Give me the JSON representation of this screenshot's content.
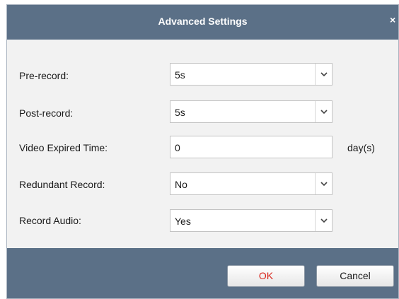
{
  "dialog": {
    "title": "Advanced Settings",
    "close_symbol": "×"
  },
  "fields": [
    {
      "label": "Pre-record:",
      "value": "5s",
      "type": "select"
    },
    {
      "label": "Post-record:",
      "value": "5s",
      "type": "select"
    },
    {
      "label": "Video Expired Time:",
      "value": "0",
      "type": "input",
      "unit": "day(s)"
    },
    {
      "label": "Redundant Record:",
      "value": "No",
      "type": "select"
    },
    {
      "label": "Record Audio:",
      "value": "Yes",
      "type": "select"
    }
  ],
  "buttons": {
    "ok_label": "OK",
    "cancel_label": "Cancel"
  },
  "colors": {
    "header": "#5b7087",
    "ok_text": "#d9261c"
  },
  "icons": {
    "dropdown": "chevron-down-icon",
    "close": "close-icon"
  }
}
